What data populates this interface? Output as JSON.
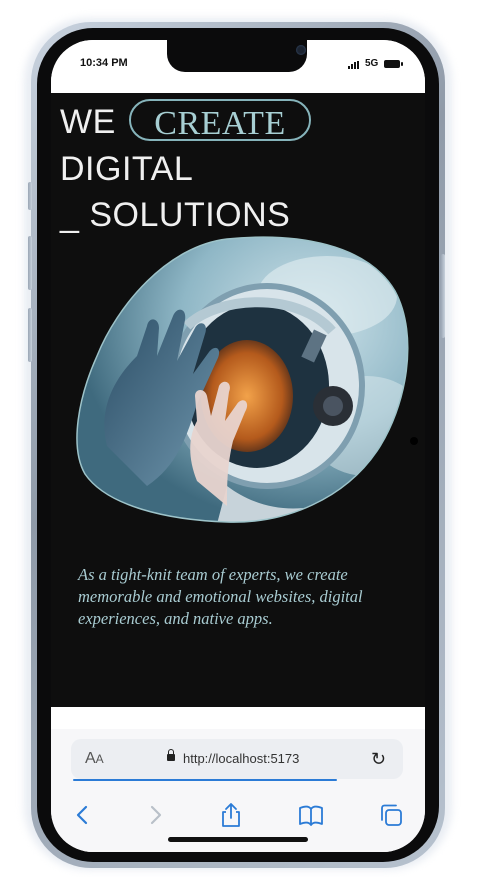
{
  "status_bar": {
    "time": "10:34 PM",
    "network": "5G"
  },
  "hero": {
    "line1_word": "WE",
    "line1_pill": "CREATE",
    "line2": "DIGITAL",
    "line3": "_ SOLUTIONS",
    "image_icon": "astronaut-photo",
    "tagline": "As a tight-knit team of experts, we create memorable and emotional websites, digital experiences, and native apps."
  },
  "browser": {
    "reader_label_big": "A",
    "reader_label_small": "A",
    "url": "http://localhost:5173",
    "load_progress": 0.8,
    "icons": [
      "back-icon",
      "forward-icon",
      "share-icon",
      "bookmarks-icon",
      "tabs-icon"
    ]
  },
  "colors": {
    "accent": "#86b4bb",
    "background": "#0e0e0e",
    "link_blue": "#2b7bd6"
  }
}
